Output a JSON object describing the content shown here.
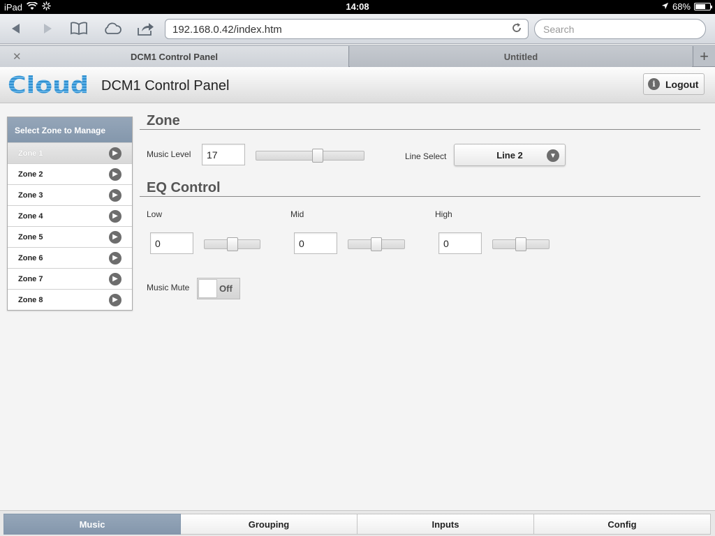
{
  "status_bar": {
    "device": "iPad",
    "time": "14:08",
    "battery": "68%",
    "battery_level": 0.68
  },
  "browser": {
    "url": "192.168.0.42/index.htm",
    "search_placeholder": "Search",
    "tabs": [
      {
        "label": "DCM1 Control Panel",
        "active": true
      },
      {
        "label": "Untitled",
        "active": false
      }
    ]
  },
  "header": {
    "logo_text": "Cloud",
    "title": "DCM1 Control Panel",
    "logout_label": "Logout"
  },
  "sidebar": {
    "heading": "Select Zone to Manage",
    "zones": [
      "Zone 1",
      "Zone 2",
      "Zone 3",
      "Zone 4",
      "Zone 5",
      "Zone 6",
      "Zone 7",
      "Zone 8"
    ],
    "selected_index": 0
  },
  "zone": {
    "title": "Zone",
    "music_level_label": "Music Level",
    "music_level_value": "17",
    "music_level_fraction": 0.58,
    "line_select_label": "Line Select",
    "line_select_value": "Line 2"
  },
  "eq": {
    "title": "EQ Control",
    "low": {
      "label": "Low",
      "value": "0",
      "fraction": 0.5
    },
    "mid": {
      "label": "Mid",
      "value": "0",
      "fraction": 0.5
    },
    "high": {
      "label": "High",
      "value": "0",
      "fraction": 0.5
    },
    "music_mute_label": "Music Mute",
    "music_mute_state": "Off"
  },
  "bottom_nav": [
    {
      "label": "Music",
      "active": true
    },
    {
      "label": "Grouping",
      "active": false
    },
    {
      "label": "Inputs",
      "active": false
    },
    {
      "label": "Config",
      "active": false
    }
  ],
  "colors": {
    "accent": "#8497ac",
    "logo_blue": "#2f8fd0"
  },
  "icons": [
    "wifi-icon",
    "loading-icon",
    "location-icon",
    "battery-icon",
    "back-icon",
    "forward-icon",
    "bookmarks-icon",
    "cloud-icon",
    "share-icon",
    "reload-icon",
    "close-icon",
    "add-tab-icon",
    "info-icon",
    "chevron-right-icon",
    "chevron-down-icon"
  ]
}
